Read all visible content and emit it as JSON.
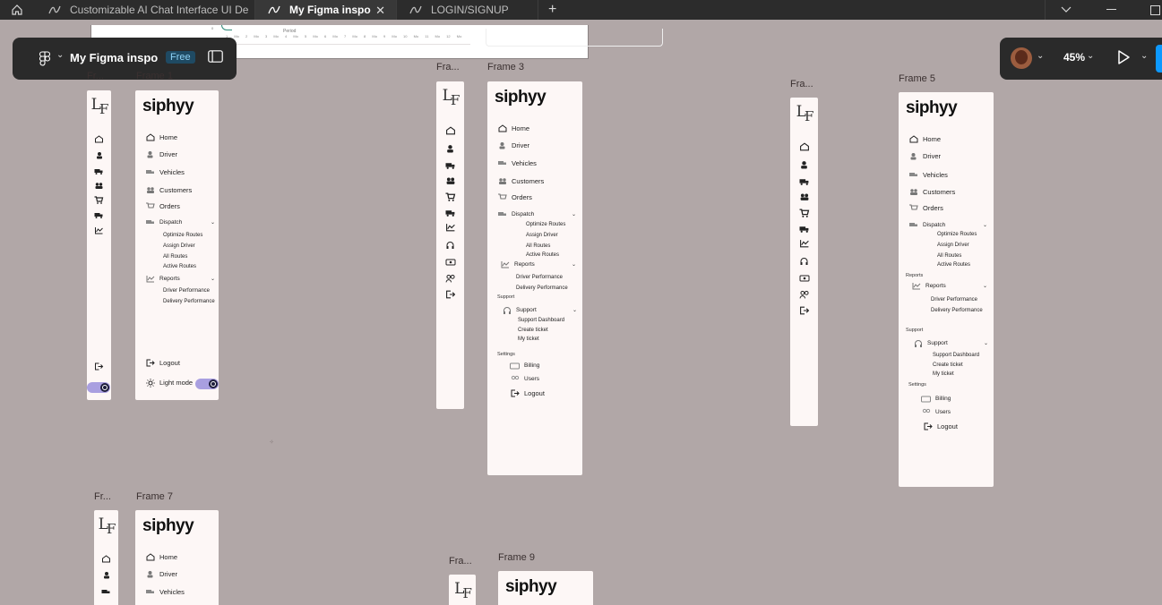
{
  "tabs": [
    {
      "label": "Customizable AI Chat Interface UI De",
      "active": false,
      "icon": "figma-file-icon"
    },
    {
      "label": "My Figma inspo",
      "active": true,
      "icon": "figma-file-icon"
    },
    {
      "label": "LOGIN/SIGNUP",
      "active": false,
      "icon": "figma-file-icon"
    }
  ],
  "toolbar": {
    "file_name": "My Figma inspo",
    "plan_badge": "Free",
    "zoom": "45%"
  },
  "chart_snippet": {
    "axis_label": "Period",
    "ticks": "1 Mo 2 Mo 3 Mo 4 Mo 5 Mo 6 Mo 7 Mo 8 Mo 9 Mo 10 Mo 11 Mo 12 Mo",
    "y_tick": "0"
  },
  "frame_labels": {
    "f_tl_small": "Fr...",
    "f_tl_full": "Frame 1",
    "f2": "Fra...",
    "f3": "Frame 3",
    "f4": "Fra...",
    "f5": "Frame 5",
    "f6": "Fr...",
    "f7": "Frame 7",
    "f8": "Fra...",
    "f9": "Frame 9"
  },
  "brand": {
    "name": "siphyy",
    "mono_a": "L",
    "mono_b": "F"
  },
  "nav": {
    "home": "Home",
    "driver": "Driver",
    "vehicles": "Vehicles",
    "customers": "Customers",
    "orders": "Orders",
    "dispatch": "Dispatch",
    "optimize_routes": "Optimize Routes",
    "assign_driver": "Assign Driver",
    "all_routes": "All Routes",
    "active_routes": "Active Routes",
    "reports": "Reports",
    "driver_performance": "Driver Performance",
    "delivery_performance": "Delivery Performance",
    "support_section": "Support",
    "support": "Support",
    "support_dashboard": "Support Dashboard",
    "create_ticket": "Create ticket",
    "my_ticket": "My ticket",
    "settings_section": "Settings",
    "billing": "Billing",
    "users": "Users",
    "logout": "Logout",
    "light_mode": "Light mode"
  },
  "colors": {
    "canvas": "#b1a7a7",
    "frame_bg": "#fdf7f6",
    "toolbar_bg": "#2a2a2a",
    "accent": "#0d99ff",
    "toggle": "#a99fe0"
  }
}
